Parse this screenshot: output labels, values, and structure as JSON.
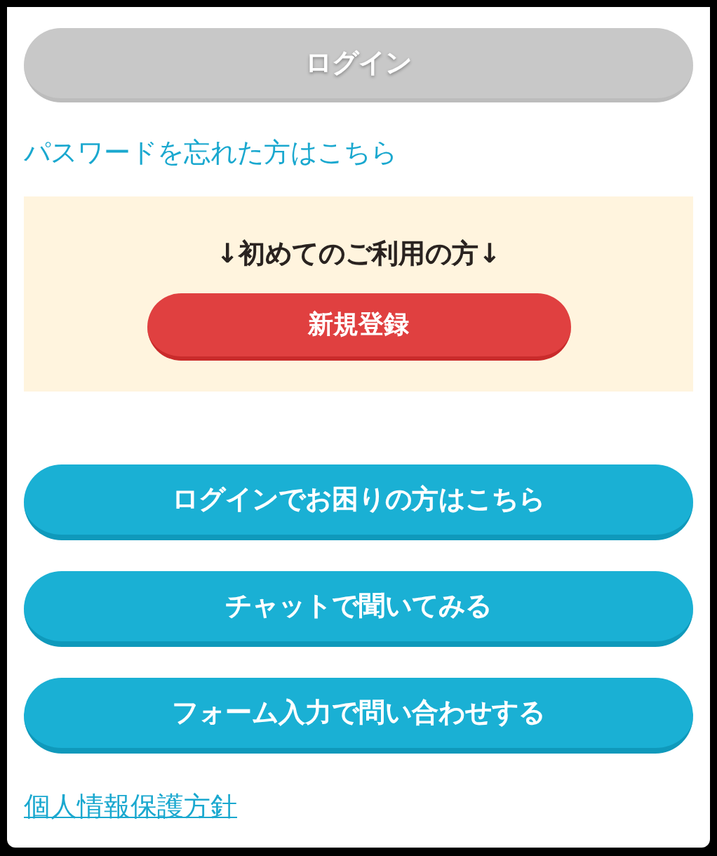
{
  "login_button": {
    "label": "ログイン",
    "disabled": true
  },
  "forgot_password_link": "パスワードを忘れた方はこちら",
  "new_user_panel": {
    "heading": "↓初めてのご利用の方↓",
    "register_button": "新規登録"
  },
  "help_buttons": [
    {
      "label": "ログインでお困りの方はこちら"
    },
    {
      "label": "チャットで聞いてみる"
    },
    {
      "label": "フォーム入力で問い合わせする"
    }
  ],
  "privacy_policy_link": "個人情報保護方針"
}
